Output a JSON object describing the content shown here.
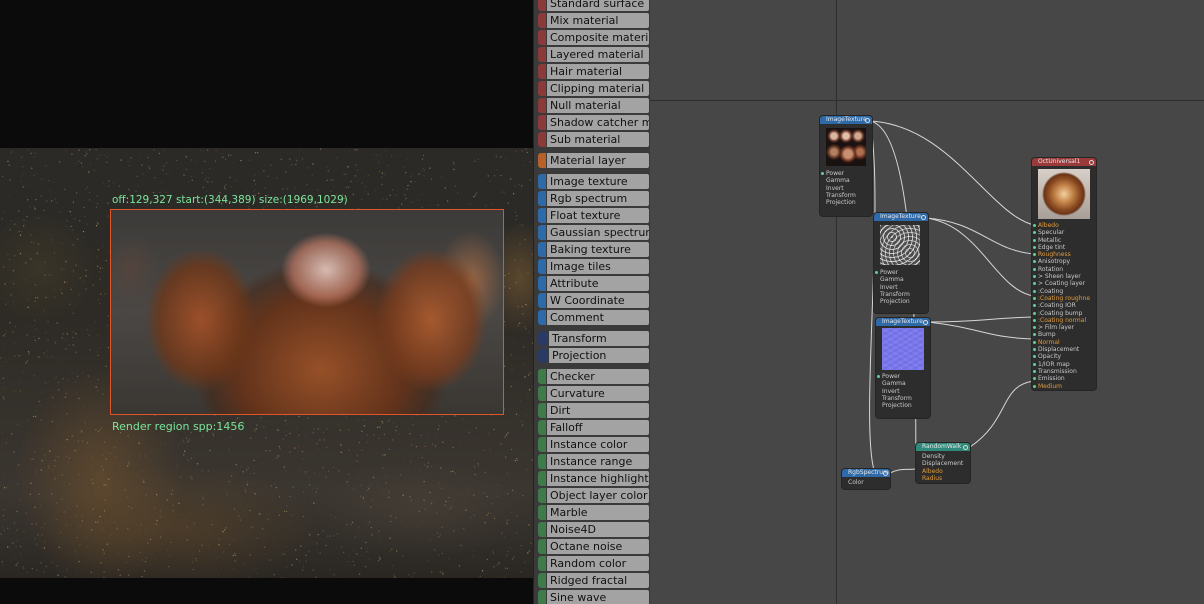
{
  "viewport": {
    "region_info": "off:129,327 start:(344,389) size:(1969,1029)",
    "region_spp": "Render region spp:1456"
  },
  "palette": {
    "items": [
      {
        "label": "Standard surface",
        "color": "#8b3a3a"
      },
      {
        "label": "Mix material",
        "color": "#8b3a3a"
      },
      {
        "label": "Composite material",
        "color": "#8b3a3a"
      },
      {
        "label": "Layered material",
        "color": "#8b3a3a"
      },
      {
        "label": "Hair material",
        "color": "#8b3a3a"
      },
      {
        "label": "Clipping material",
        "color": "#8b3a3a"
      },
      {
        "label": "Null material",
        "color": "#8b3a3a"
      },
      {
        "label": "Shadow catcher material",
        "color": "#8b3a3a"
      },
      {
        "label": "Sub material",
        "color": "#8b3a3a"
      },
      {
        "label": "Material layer",
        "color": "#b8602a"
      },
      {
        "label": "Image texture",
        "color": "#2f6aa8"
      },
      {
        "label": "Rgb spectrum",
        "color": "#2f6aa8"
      },
      {
        "label": "Float texture",
        "color": "#2f6aa8"
      },
      {
        "label": "Gaussian spectrum",
        "color": "#2f6aa8"
      },
      {
        "label": "Baking texture",
        "color": "#2f6aa8"
      },
      {
        "label": "Image tiles",
        "color": "#2f6aa8"
      },
      {
        "label": "Attribute",
        "color": "#2f6aa8"
      },
      {
        "label": "W Coordinate",
        "color": "#2f6aa8"
      },
      {
        "label": "Comment",
        "color": "#2f6aa8"
      },
      {
        "label": "Transform",
        "color": "#2a3a66"
      },
      {
        "label": "Projection",
        "color": "#2a3a66"
      },
      {
        "label": "Checker",
        "color": "#3f7a4a"
      },
      {
        "label": "Curvature",
        "color": "#3f7a4a"
      },
      {
        "label": "Dirt",
        "color": "#3f7a4a"
      },
      {
        "label": "Falloff",
        "color": "#3f7a4a"
      },
      {
        "label": "Instance color",
        "color": "#3f7a4a"
      },
      {
        "label": "Instance range",
        "color": "#3f7a4a"
      },
      {
        "label": "Instance highlight",
        "color": "#3f7a4a"
      },
      {
        "label": "Object layer color",
        "color": "#3f7a4a"
      },
      {
        "label": "Marble",
        "color": "#3f7a4a"
      },
      {
        "label": "Noise4D",
        "color": "#3f7a4a"
      },
      {
        "label": "Octane noise",
        "color": "#3f7a4a"
      },
      {
        "label": "Random color",
        "color": "#3f7a4a"
      },
      {
        "label": "Ridged fractal",
        "color": "#3f7a4a"
      },
      {
        "label": "Sine wave",
        "color": "#3f7a4a"
      }
    ]
  },
  "graph": {
    "nodes": {
      "img1": {
        "title": "ImageTexture",
        "pins": [
          "Power",
          "Gamma",
          "Invert",
          "Transform",
          "Projection"
        ]
      },
      "img2": {
        "title": "ImageTexture",
        "pins": [
          "Power",
          "Gamma",
          "Invert",
          "Transform",
          "Projection"
        ]
      },
      "img3": {
        "title": "ImageTexture",
        "pins": [
          "Power",
          "Gamma",
          "Invert",
          "Transform",
          "Projection"
        ]
      },
      "universal": {
        "title": "OctUniversal1",
        "pins": [
          "Albedo",
          "Specular",
          "Metallic",
          "Edge tint",
          "Roughness",
          "Anisotropy",
          "Rotation",
          "> Sheen layer",
          "> Coating layer",
          ":Coating",
          ":Coating roughne",
          ":Coating IOR",
          ":Coating bump",
          ":Coating normal",
          "> Film layer",
          "Bump",
          "Normal",
          "Displacement",
          "Opacity",
          "1/IOR map",
          "Transmission",
          "Emission",
          "Medium"
        ],
        "highlighted": [
          "Albedo",
          "Roughness",
          ":Coating roughne",
          ":Coating normal",
          "Normal",
          "Medium"
        ]
      },
      "randomwalk": {
        "title": "RandomWalk",
        "pins": [
          "Density",
          "Displacement",
          "Albedo",
          "Radius"
        ],
        "highlighted": [
          "Albedo",
          "Radius"
        ]
      },
      "rgb": {
        "title": "RgbSpectrum",
        "pins": [
          "Color"
        ]
      }
    },
    "colors": {
      "texture_header": "#2f6aa8",
      "material_header": "#9a3a3a",
      "medium_header": "#2f8a7a",
      "highlight_pin": "#e09a3a",
      "wire": "#e6e6e6"
    }
  }
}
